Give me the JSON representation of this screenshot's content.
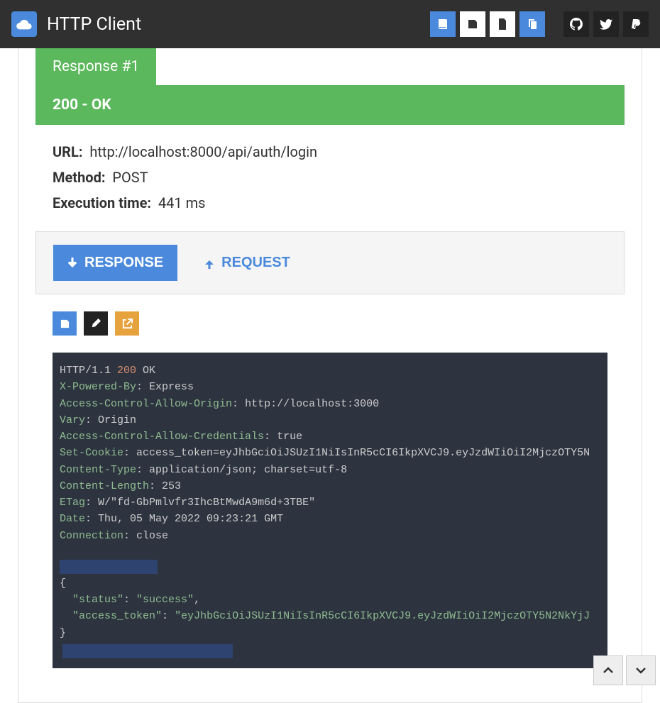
{
  "app": {
    "title": "HTTP Client"
  },
  "tabs": [
    {
      "label": "Response #1"
    }
  ],
  "response": {
    "status_text": "200 - OK",
    "url_label": "URL:",
    "url_value": "http://localhost:8000/api/auth/login",
    "method_label": "Method:",
    "method_value": "POST",
    "exec_label": "Execution time:",
    "exec_value": "441 ms"
  },
  "subnav": {
    "response_label": "RESPONSE",
    "request_label": "REQUEST"
  },
  "raw": {
    "protocol": "HTTP/1.1 ",
    "status_code": "200",
    "status_msg": " OK",
    "headers": [
      {
        "k": "X-Powered-By",
        "v": "Express"
      },
      {
        "k": "Access-Control-Allow-Origin",
        "v": "http://localhost:3000"
      },
      {
        "k": "Vary",
        "v": "Origin"
      },
      {
        "k": "Access-Control-Allow-Credentials",
        "v": "true"
      },
      {
        "k": "Set-Cookie",
        "v": "access_token=eyJhbGciOiJSUzI1NiIsInR5cCI6IkpXVCJ9.eyJzdWIiOiI2MjczOTY5N"
      },
      {
        "k": "Content-Type",
        "v": "application/json; charset=utf-8"
      },
      {
        "k": "Content-Length",
        "v": "253"
      },
      {
        "k": "ETag",
        "v": "W/\"fd-GbPmlvfr3IhcBtMwdA9m6d+3TBE\""
      },
      {
        "k": "Date",
        "v": "Thu, 05 May 2022 09:23:21 GMT"
      },
      {
        "k": "Connection",
        "v": "close"
      }
    ],
    "body_open": "{",
    "body_status_k": "\"status\"",
    "body_status_v": "\"success\"",
    "body_token_k": "\"access_token\"",
    "body_token_v": "\"eyJhbGciOiJSUzI1NiIsInR5cCI6IkpXVCJ9.eyJzdWIiOiI2MjczOTY5N2NkYjJ",
    "body_close": "}"
  }
}
